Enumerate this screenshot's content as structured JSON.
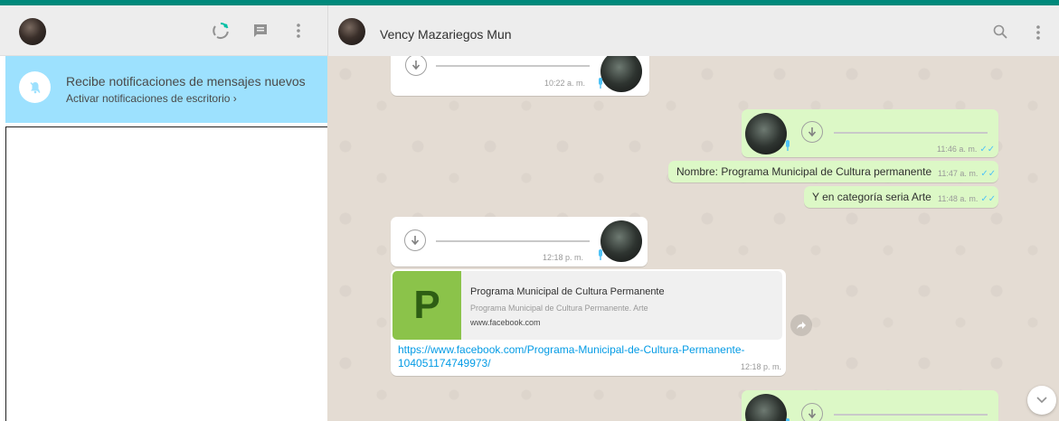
{
  "colors": {
    "accent": "#00897b",
    "notification_bg": "#9de1fe",
    "incoming_bubble": "#ffffff",
    "outgoing_bubble": "#dcf8c6",
    "link": "#039be5",
    "read_ticks": "#4fc3f7"
  },
  "left_header": {
    "icons": [
      "user-avatar",
      "status-icon",
      "new-chat-icon",
      "menu-icon"
    ]
  },
  "notification": {
    "icon": "bell-off-icon",
    "title": "Recibe notificaciones de mensajes nuevos",
    "link_text": "Activar notificaciones de escritorio ›"
  },
  "chat_header": {
    "contact_name": "Vency Mazariegos Mun",
    "icons": [
      "search-icon",
      "menu-icon"
    ]
  },
  "messages": [
    {
      "kind": "voice",
      "direction": "in",
      "time": "10:22 a. m."
    },
    {
      "kind": "voice",
      "direction": "out",
      "time": "11:46 a. m."
    },
    {
      "kind": "text",
      "direction": "out",
      "text": "Nombre: Programa Municipal de Cultura permanente",
      "time": "11:47 a. m."
    },
    {
      "kind": "text",
      "direction": "out",
      "text": "Y en categoría seria Arte",
      "time": "11:48 a. m."
    },
    {
      "kind": "voice",
      "direction": "in",
      "time": "12:18 p. m."
    },
    {
      "kind": "link",
      "direction": "in",
      "preview_letter": "P",
      "preview_title": "Programa Municipal de Cultura Permanente",
      "preview_desc": "Programa Municipal de Cultura Permanente. Arte",
      "preview_site": "www.facebook.com",
      "url": "https://www.facebook.com/Programa-Municipal-de-Cultura-Permanente-104051174749973/",
      "time": "12:18 p. m."
    },
    {
      "kind": "voice",
      "direction": "out",
      "time": ""
    }
  ]
}
